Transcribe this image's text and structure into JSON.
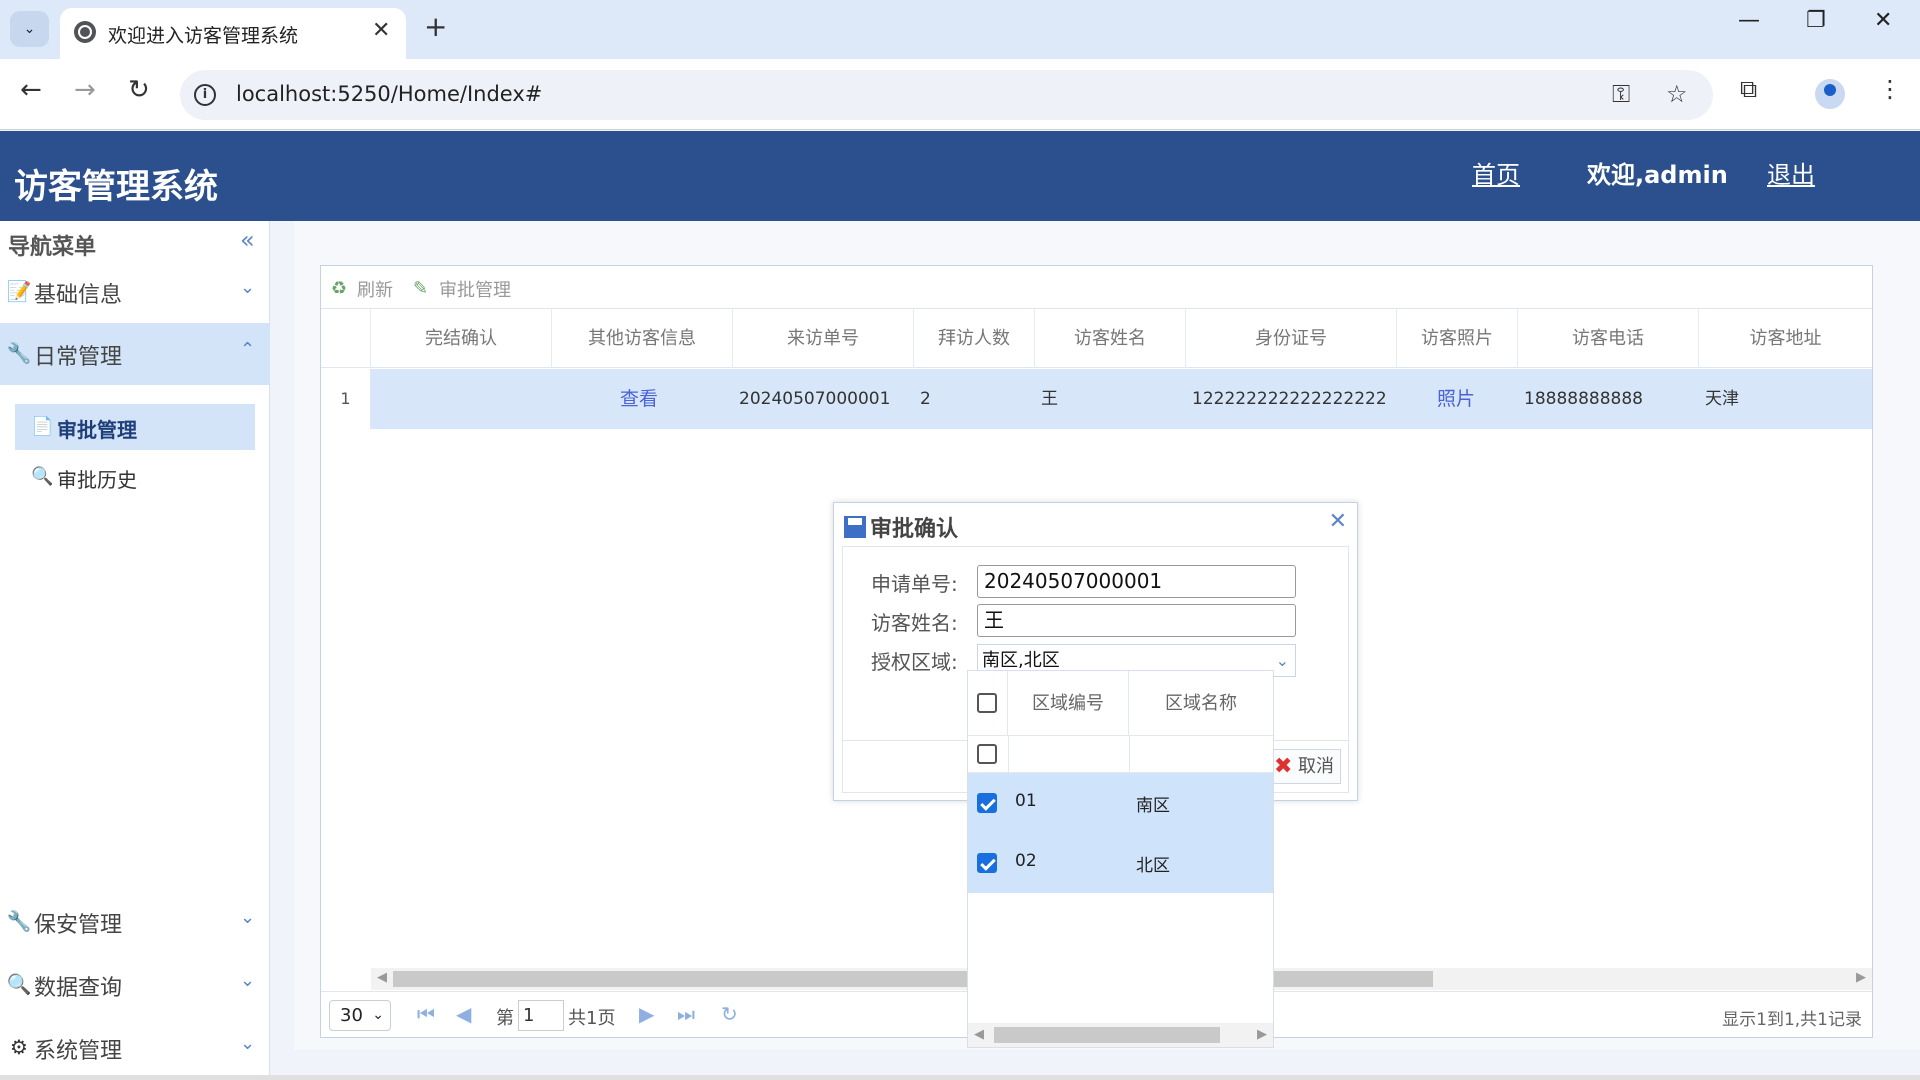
{
  "browser": {
    "tab_title": "欢迎进入访客管理系统",
    "url": "localhost:5250/Home/Index#"
  },
  "header": {
    "title": "访客管理系统",
    "home_link": "首页",
    "welcome": "欢迎,admin",
    "logout": "退出"
  },
  "sidebar": {
    "title": "导航菜单",
    "groups": [
      {
        "label": "基础信息",
        "icon": "notebook-icon"
      },
      {
        "label": "日常管理",
        "icon": "wrench-icon",
        "expanded": true
      },
      {
        "label": "保安管理",
        "icon": "wrench-icon"
      },
      {
        "label": "数据查询",
        "icon": "search-icon"
      },
      {
        "label": "系统管理",
        "icon": "gear-icon"
      }
    ],
    "subitems": [
      {
        "label": "审批管理",
        "icon": "document-gear-icon",
        "active": true
      },
      {
        "label": "审批历史",
        "icon": "search-icon"
      }
    ]
  },
  "grid": {
    "toolbar": {
      "refresh": "刷新",
      "approve": "审批管理"
    },
    "columns": [
      "完结确认",
      "其他访客信息",
      "来访单号",
      "拜访人数",
      "访客姓名",
      "身份证号",
      "访客照片",
      "访客电话",
      "访客地址"
    ],
    "row": {
      "num": "1",
      "other_info": "查看",
      "order_no": "20240507000001",
      "visitor_count": "2",
      "visitor_name": "王",
      "id_number": "122222222222222222",
      "photo": "照片",
      "phone": "18888888888",
      "address": "天津"
    },
    "pager": {
      "page_size": "30",
      "page_prefix": "第",
      "page_value": "1",
      "page_total": "共1页",
      "summary": "显示1到1,共1记录"
    }
  },
  "dialog": {
    "title": "审批确认",
    "fields": {
      "order_label": "申请单号:",
      "order_value": "20240507000001",
      "name_label": "访客姓名:",
      "name_value": "王",
      "region_label": "授权区域:",
      "region_value": "南区,北区"
    },
    "cancel": "取消"
  },
  "combo": {
    "col_code": "区域编号",
    "col_name": "区域名称",
    "rows": [
      {
        "code": "01",
        "name": "南区",
        "checked": true
      },
      {
        "code": "02",
        "name": "北区",
        "checked": true
      }
    ]
  },
  "colors": {
    "header_bg": "#2c4f8e",
    "selected_row": "#d7e6f8",
    "link": "#4a63d8"
  }
}
